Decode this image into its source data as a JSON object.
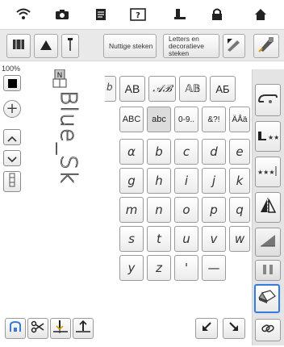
{
  "status_icons": [
    "wifi-icon",
    "camera-icon",
    "document-icon",
    "help-icon",
    "presser-foot-icon",
    "lock-icon",
    "home-icon"
  ],
  "toolbar": {
    "button_1_icon": "thread-spool-icon",
    "button_2_icon": "triangle-icon",
    "button_3_icon": "needle-icon",
    "useful_stitches_label": "Nuttige steken",
    "letters_label": "Letters en decoratieve steken",
    "edit_icon": "pencil-edit-icon",
    "embroidery_icon": "embroidery-icon"
  },
  "left": {
    "zoom": "100%",
    "preview_text": "Blue_Sk"
  },
  "font_tabs": [
    "AB",
    "𝒜ℬ",
    "𝔸𝔹",
    "AБ"
  ],
  "char_tabs": [
    "ABC",
    "abc",
    "0-9..",
    "&?!",
    "ÄÅä"
  ],
  "characters": [
    [
      "α",
      "b",
      "c",
      "d",
      "e"
    ],
    [
      "g",
      "h",
      "i",
      "j",
      "k"
    ],
    [
      "m",
      "n",
      "o",
      "p",
      "q"
    ],
    [
      "s",
      "t",
      "u",
      "v",
      "w"
    ],
    [
      "y",
      "z",
      "'",
      "—"
    ]
  ],
  "bottom_buttons": [
    "presser-foot-lift-icon",
    "scissors-icon",
    "needle-down-icon",
    "needle-up-icon"
  ],
  "nav": [
    "arrow-down-left-icon",
    "arrow-down-right-icon"
  ],
  "accent_color": "#3a7bd5"
}
